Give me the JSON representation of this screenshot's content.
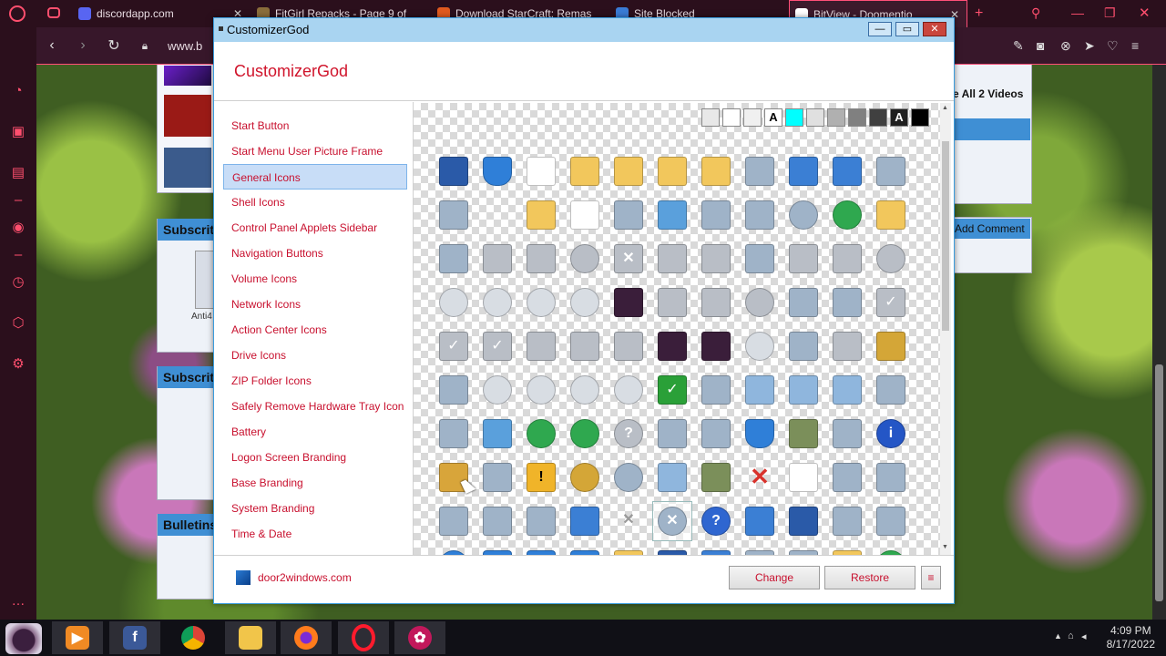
{
  "browser": {
    "tabs": [
      {
        "label": "discordapp.com",
        "icon": "discord-icon",
        "color": "#5865f2"
      },
      {
        "label": "FitGirl Repacks - Page 9 of",
        "icon": "fitgirl-icon",
        "color": "#8a6d3b"
      },
      {
        "label": "Download StarCraft: Remas",
        "icon": "download-icon",
        "color": "#e05a1f"
      },
      {
        "label": "Site Blocked",
        "icon": "shield-icon",
        "color": "#3a7bd5"
      },
      {
        "label": "BitView - Doomentio",
        "icon": "bitview-icon",
        "color": "#ffffff"
      }
    ],
    "url": "www.b"
  },
  "background_page": {
    "videos_label": "e All 2 Videos",
    "add_comment": "Add Comment",
    "subscribers_header": "Subscrit",
    "subscriptions_header": "Subscrit",
    "bulletins_header": "Bulletins",
    "user_label": "Anti4"
  },
  "app": {
    "window_title": "CustomizerGod",
    "heading": "CustomizerGod",
    "nav_items": [
      "Start Button",
      "Start Menu User Picture Frame",
      "General Icons",
      "Shell Icons",
      "Control Panel Applets Sidebar",
      "Navigation Buttons",
      "Volume Icons",
      "Network Icons",
      "Action Center Icons",
      "Drive Icons",
      "ZIP Folder Icons",
      "Safely Remove Hardware Tray Icon",
      "Battery",
      "Logon Screen Branding",
      "Base Branding",
      "System Branding",
      "Time & Date"
    ],
    "selected_nav": "General Icons",
    "swatches": [
      {
        "color": "#e8e8e8",
        "label": ""
      },
      {
        "color": "#ffffff",
        "label": ""
      },
      {
        "color": "#f0f0f0",
        "label": ""
      },
      {
        "color": "#ffffff",
        "label": "A"
      },
      {
        "color": "#00ffff",
        "label": ""
      },
      {
        "color": "#e0e0e0",
        "label": ""
      },
      {
        "color": "#b0b0b0",
        "label": ""
      },
      {
        "color": "#808080",
        "label": ""
      },
      {
        "color": "#404040",
        "label": ""
      },
      {
        "color": "#202020",
        "label": "A"
      },
      {
        "color": "#000000",
        "label": ""
      }
    ],
    "footer_link": "door2windows.com",
    "change_button": "Change",
    "restore_button": "Restore",
    "menu_button": "≡",
    "icon_rows": [
      [
        "monitor",
        "shield",
        "document",
        "folder",
        "folder",
        "folder",
        "folder-narrow",
        "search-doc",
        "file-blue",
        "bar-blue",
        "puzzle"
      ],
      [
        "window-app",
        "",
        "folder-search",
        "document",
        "mail",
        "picture-frame",
        "calculator",
        "film",
        "colors",
        "globe-pc",
        "folder-drive"
      ],
      [
        "remote-desktop",
        "drive-purple",
        "drive-dark",
        "drive-cd",
        "drive-error",
        "drive",
        "drive-green",
        "ram",
        "drive-flat",
        "drive-windows",
        "drive-dvd"
      ],
      [
        "disc-dvd-r",
        "disc-dvd-ram",
        "disc-dvd-rom",
        "disc-dvd-rw",
        "gremlin",
        "drive-gear",
        "drive-blue",
        "drive-globe",
        "phone-screen",
        "mobile",
        "drive-check"
      ],
      [
        "drive-check",
        "drive-ok",
        "drive-network",
        "drive-purple",
        "drive-green",
        "gremlin",
        "gremlin",
        "disc-dvd",
        "camera",
        "drive-silver",
        "lock"
      ],
      [
        "memory-card",
        "disc",
        "disc-cd-r",
        "disc-cd-rom",
        "disc-cd-rw",
        "blue-book",
        "remote",
        "gear-page",
        "gear-page",
        "gear-page",
        "paint-box"
      ],
      [
        "landscape",
        "picture",
        "globe-user",
        "globe-user",
        "drive-help",
        "printer",
        "font",
        "uac-shield",
        "users",
        "server",
        "info"
      ],
      [
        "key",
        "flowers",
        "warning",
        "clock-refresh",
        "move-arrows",
        "gear-doc",
        "user-group",
        "red-x",
        "document-list",
        "printer-pc",
        "window-frame"
      ],
      [
        "pda",
        "screen-resize",
        "scanner",
        "blue-box",
        "grey-x",
        "close-circle",
        "help",
        "blue-frame",
        "monitor-blue",
        "blank-doc",
        "presentation"
      ],
      [
        "help-shield",
        "error-shield",
        "ok-shield",
        "warning-shield",
        "folder-drive",
        "monitor-dark",
        "blue-rect",
        "bar-chart",
        "paper",
        "folder-open",
        "gear-globe"
      ]
    ],
    "highlighted_icon": "close-circle"
  },
  "taskbar": {
    "apps": [
      "gremlin-avatar",
      "media-player",
      "facebook",
      "chrome",
      "file-explorer",
      "firefox",
      "opera",
      "customizer"
    ],
    "time": "4:09 PM",
    "date": "8/17/2022"
  }
}
